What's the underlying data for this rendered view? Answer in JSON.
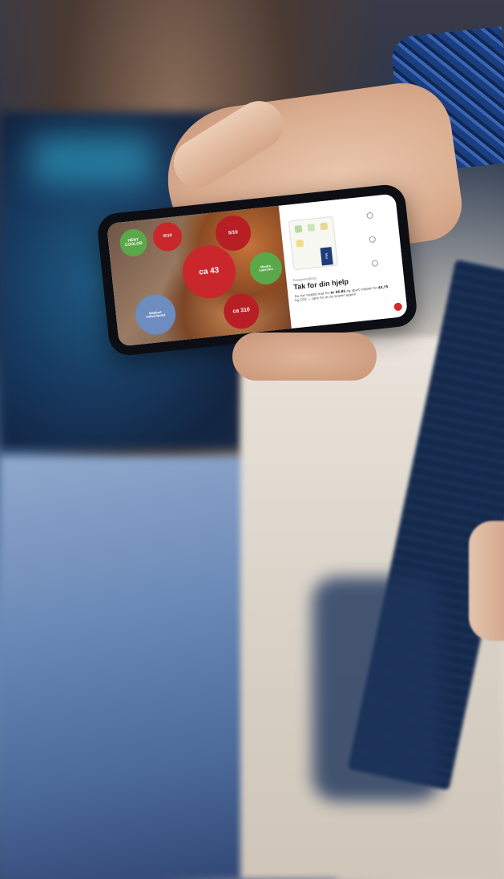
{
  "app_screen": {
    "bubbles": [
      {
        "id": "tekst-top-left",
        "big": "HENT\nCOOLOR",
        "small": "...",
        "color": "#5aa84a"
      },
      {
        "id": "red-small",
        "big": "2019",
        "small": "...",
        "color": "#c9272b"
      },
      {
        "id": "red-large",
        "big": "ca 43",
        "sup": "%",
        "small": "...",
        "color": "#c9272b"
      },
      {
        "id": "red-5-10",
        "big": "5/10",
        "small": "...",
        "color": "#b71f25"
      },
      {
        "id": "green-right",
        "big": "Mindre\nmatsvinn",
        "small": "...",
        "color": "#5aa84a"
      },
      {
        "id": "blue",
        "big": "Mattbud\nredistributed",
        "small": "...",
        "color": "#6d8cc0"
      },
      {
        "id": "red-bottom",
        "big": "ca 310",
        "sup": "kr",
        "small": "...",
        "color": "#b71f25"
      }
    ],
    "panel": {
      "kicker": "Pressemelding",
      "title": "Tak for din hjelp",
      "body_prefix": "Du har reddet mat for ",
      "body_bold_1": "kr 56.85",
      "body_middle": " og spart miljøet for ",
      "body_bold_2": "43,75",
      "body_suffix": " kg CO2 — takk for at du bruker appen.",
      "button_label": "Mer"
    }
  },
  "colors": {
    "accent_red": "#c9272b",
    "accent_green": "#5aa84a",
    "accent_blue": "#6d8cc0"
  }
}
